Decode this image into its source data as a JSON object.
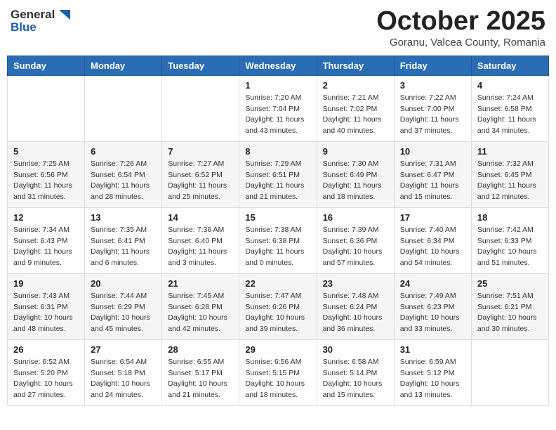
{
  "header": {
    "logo_general": "General",
    "logo_blue": "Blue",
    "month_title": "October 2025",
    "subtitle": "Goranu, Valcea County, Romania"
  },
  "weekdays": [
    "Sunday",
    "Monday",
    "Tuesday",
    "Wednesday",
    "Thursday",
    "Friday",
    "Saturday"
  ],
  "weeks": [
    [
      {
        "day": "",
        "info": ""
      },
      {
        "day": "",
        "info": ""
      },
      {
        "day": "",
        "info": ""
      },
      {
        "day": "1",
        "info": "Sunrise: 7:20 AM\nSunset: 7:04 PM\nDaylight: 11 hours\nand 43 minutes."
      },
      {
        "day": "2",
        "info": "Sunrise: 7:21 AM\nSunset: 7:02 PM\nDaylight: 11 hours\nand 40 minutes."
      },
      {
        "day": "3",
        "info": "Sunrise: 7:22 AM\nSunset: 7:00 PM\nDaylight: 11 hours\nand 37 minutes."
      },
      {
        "day": "4",
        "info": "Sunrise: 7:24 AM\nSunset: 6:58 PM\nDaylight: 11 hours\nand 34 minutes."
      }
    ],
    [
      {
        "day": "5",
        "info": "Sunrise: 7:25 AM\nSunset: 6:56 PM\nDaylight: 11 hours\nand 31 minutes."
      },
      {
        "day": "6",
        "info": "Sunrise: 7:26 AM\nSunset: 6:54 PM\nDaylight: 11 hours\nand 28 minutes."
      },
      {
        "day": "7",
        "info": "Sunrise: 7:27 AM\nSunset: 6:52 PM\nDaylight: 11 hours\nand 25 minutes."
      },
      {
        "day": "8",
        "info": "Sunrise: 7:29 AM\nSunset: 6:51 PM\nDaylight: 11 hours\nand 21 minutes."
      },
      {
        "day": "9",
        "info": "Sunrise: 7:30 AM\nSunset: 6:49 PM\nDaylight: 11 hours\nand 18 minutes."
      },
      {
        "day": "10",
        "info": "Sunrise: 7:31 AM\nSunset: 6:47 PM\nDaylight: 11 hours\nand 15 minutes."
      },
      {
        "day": "11",
        "info": "Sunrise: 7:32 AM\nSunset: 6:45 PM\nDaylight: 11 hours\nand 12 minutes."
      }
    ],
    [
      {
        "day": "12",
        "info": "Sunrise: 7:34 AM\nSunset: 6:43 PM\nDaylight: 11 hours\nand 9 minutes."
      },
      {
        "day": "13",
        "info": "Sunrise: 7:35 AM\nSunset: 6:41 PM\nDaylight: 11 hours\nand 6 minutes."
      },
      {
        "day": "14",
        "info": "Sunrise: 7:36 AM\nSunset: 6:40 PM\nDaylight: 11 hours\nand 3 minutes."
      },
      {
        "day": "15",
        "info": "Sunrise: 7:38 AM\nSunset: 6:38 PM\nDaylight: 11 hours\nand 0 minutes."
      },
      {
        "day": "16",
        "info": "Sunrise: 7:39 AM\nSunset: 6:36 PM\nDaylight: 10 hours\nand 57 minutes."
      },
      {
        "day": "17",
        "info": "Sunrise: 7:40 AM\nSunset: 6:34 PM\nDaylight: 10 hours\nand 54 minutes."
      },
      {
        "day": "18",
        "info": "Sunrise: 7:42 AM\nSunset: 6:33 PM\nDaylight: 10 hours\nand 51 minutes."
      }
    ],
    [
      {
        "day": "19",
        "info": "Sunrise: 7:43 AM\nSunset: 6:31 PM\nDaylight: 10 hours\nand 48 minutes."
      },
      {
        "day": "20",
        "info": "Sunrise: 7:44 AM\nSunset: 6:29 PM\nDaylight: 10 hours\nand 45 minutes."
      },
      {
        "day": "21",
        "info": "Sunrise: 7:45 AM\nSunset: 6:28 PM\nDaylight: 10 hours\nand 42 minutes."
      },
      {
        "day": "22",
        "info": "Sunrise: 7:47 AM\nSunset: 6:26 PM\nDaylight: 10 hours\nand 39 minutes."
      },
      {
        "day": "23",
        "info": "Sunrise: 7:48 AM\nSunset: 6:24 PM\nDaylight: 10 hours\nand 36 minutes."
      },
      {
        "day": "24",
        "info": "Sunrise: 7:49 AM\nSunset: 6:23 PM\nDaylight: 10 hours\nand 33 minutes."
      },
      {
        "day": "25",
        "info": "Sunrise: 7:51 AM\nSunset: 6:21 PM\nDaylight: 10 hours\nand 30 minutes."
      }
    ],
    [
      {
        "day": "26",
        "info": "Sunrise: 6:52 AM\nSunset: 5:20 PM\nDaylight: 10 hours\nand 27 minutes."
      },
      {
        "day": "27",
        "info": "Sunrise: 6:54 AM\nSunset: 5:18 PM\nDaylight: 10 hours\nand 24 minutes."
      },
      {
        "day": "28",
        "info": "Sunrise: 6:55 AM\nSunset: 5:17 PM\nDaylight: 10 hours\nand 21 minutes."
      },
      {
        "day": "29",
        "info": "Sunrise: 6:56 AM\nSunset: 5:15 PM\nDaylight: 10 hours\nand 18 minutes."
      },
      {
        "day": "30",
        "info": "Sunrise: 6:58 AM\nSunset: 5:14 PM\nDaylight: 10 hours\nand 15 minutes."
      },
      {
        "day": "31",
        "info": "Sunrise: 6:59 AM\nSunset: 5:12 PM\nDaylight: 10 hours\nand 13 minutes."
      },
      {
        "day": "",
        "info": ""
      }
    ]
  ]
}
